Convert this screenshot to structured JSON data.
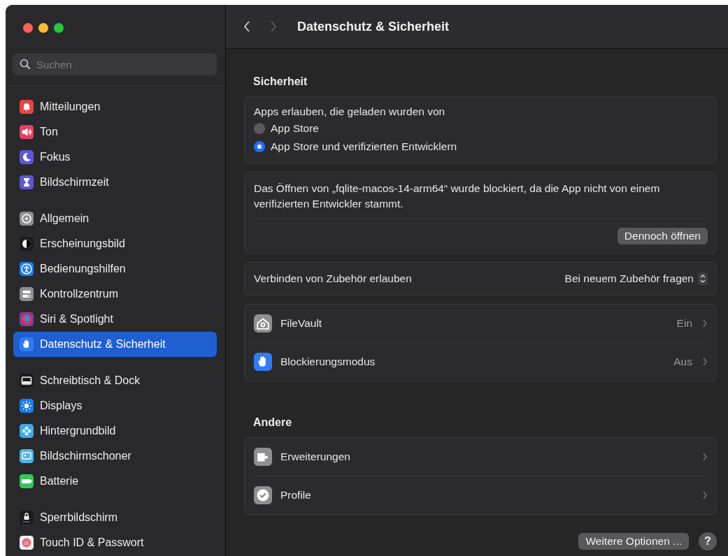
{
  "search": {
    "placeholder": "Suchen"
  },
  "sidebar": {
    "groups": [
      {
        "items": [
          {
            "label": "Mitteilungen",
            "kind": "bell",
            "color": "#e8463f",
            "selected": false
          },
          {
            "label": "Ton",
            "kind": "speaker",
            "color": "#e83e62",
            "selected": false
          },
          {
            "label": "Fokus",
            "kind": "moon",
            "color": "#5e55d8",
            "selected": false
          },
          {
            "label": "Bildschirmzeit",
            "kind": "hourglass",
            "color": "#5e55d8",
            "selected": false
          }
        ]
      },
      {
        "items": [
          {
            "label": "Allgemein",
            "kind": "gear",
            "color": "#8e8e93",
            "selected": false
          },
          {
            "label": "Erscheinungsbild",
            "kind": "contrast",
            "color": "#1c1c1e",
            "selected": false
          },
          {
            "label": "Bedienungshilfen",
            "kind": "person",
            "color": "#1a7cf2",
            "selected": false
          },
          {
            "label": "Kontrollzentrum",
            "kind": "toggles",
            "color": "#8e8e93",
            "selected": false
          },
          {
            "label": "Siri & Spotlight",
            "kind": "orb",
            "color": "#8a3b8f",
            "selected": false
          },
          {
            "label": "Datenschutz & Sicherheit",
            "kind": "hand",
            "color": "#2f7cf6",
            "selected": true
          }
        ]
      },
      {
        "items": [
          {
            "label": "Schreibtisch & Dock",
            "kind": "dock",
            "color": "#1c1c1e",
            "selected": false
          },
          {
            "label": "Displays",
            "kind": "sun",
            "color": "#1a7cf2",
            "selected": false
          },
          {
            "label": "Hintergrundbild",
            "kind": "flower",
            "color": "#3fa9e8",
            "selected": false
          },
          {
            "label": "Bildschirmschoner",
            "kind": "screen",
            "color": "#4fb3e3",
            "selected": false
          },
          {
            "label": "Batterie",
            "kind": "battery",
            "color": "#34c759",
            "selected": false
          }
        ]
      },
      {
        "items": [
          {
            "label": "Sperrbildschirm",
            "kind": "lock",
            "color": "#1c1c1e",
            "selected": false
          },
          {
            "label": "Touch ID & Passwort",
            "kind": "fingerprint",
            "color": "#f2f2f2",
            "selected": false
          }
        ]
      }
    ]
  },
  "header": {
    "title": "Datenschutz & Sicherheit",
    "back": {
      "disabled": false
    },
    "forward": {
      "disabled": true
    }
  },
  "sections": [
    {
      "heading": "Sicherheit",
      "cards": [
        {
          "kind": "radio_group",
          "label": "Apps erlauben, die geladen wurden von",
          "options": [
            {
              "label": "App Store",
              "selected": false
            },
            {
              "label": "App Store und verifizierten Entwicklern",
              "selected": true
            }
          ]
        },
        {
          "kind": "notice",
          "text": "Das Öffnen von „fqlite-macos-14-arm64“ wurde blockiert, da die App nicht von einem verifizierten Entwickler stammt.",
          "button": "Dennoch öffnen"
        },
        {
          "kind": "popup_row",
          "label": "Verbinden von Zubehör erlauben",
          "value": "Bei neuem Zubehör fragen"
        },
        {
          "kind": "nav_list",
          "rows": [
            {
              "label": "FileVault",
              "value": "Ein",
              "kind": "house",
              "color": "#8e8e93"
            },
            {
              "label": "Blockierungsmodus",
              "value": "Aus",
              "kind": "hand",
              "color": "#2f7cf6"
            }
          ]
        }
      ]
    },
    {
      "heading": "Andere",
      "cards": [
        {
          "kind": "nav_list",
          "rows": [
            {
              "label": "Erweiterungen",
              "kind": "puzzle",
              "color": "#8e8e93"
            },
            {
              "label": "Profile",
              "kind": "check",
              "color": "#8e8e93"
            }
          ]
        }
      ]
    }
  ],
  "footer": {
    "button": "Weitere Optionen ...",
    "help": "?"
  }
}
